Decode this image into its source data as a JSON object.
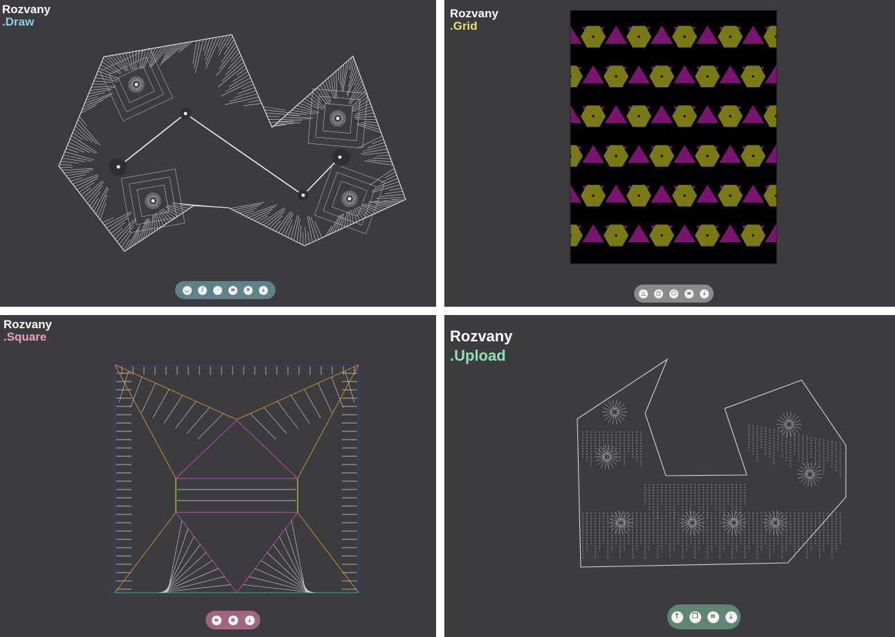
{
  "panels": {
    "draw": {
      "app_title": "Rozvany",
      "mode": ".Draw",
      "mode_color": "#8ecfe0",
      "toolbar_color": "#5e818c",
      "toolbar": [
        {
          "icon": "undo-icon",
          "glyph": "◡"
        },
        {
          "icon": "line-icon",
          "glyph": "/"
        },
        {
          "icon": "point-icon",
          "glyph": "·"
        },
        {
          "icon": "layers-icon",
          "glyph": "≡"
        },
        {
          "icon": "clear-icon",
          "glyph": "✕"
        },
        {
          "icon": "download-icon",
          "glyph": "⤓"
        }
      ]
    },
    "grid": {
      "app_title": "Rozvany",
      "mode": ".Grid",
      "mode_color": "#e5e07a",
      "toolbar_color": "#8b8b8b",
      "colors": {
        "hex": "#7a7a14",
        "tri": "#7a1470",
        "band": "#138080"
      },
      "toolbar": [
        {
          "icon": "triangle-icon",
          "glyph": "△"
        },
        {
          "icon": "square-icon",
          "glyph": "◻"
        },
        {
          "icon": "hexagon-icon",
          "glyph": "⬡"
        },
        {
          "icon": "layers-icon",
          "glyph": "≡"
        },
        {
          "icon": "download-icon",
          "glyph": "⤓"
        }
      ]
    },
    "square": {
      "app_title": "Rozvany",
      "mode": ".Square",
      "mode_color": "#f09ac8",
      "toolbar_color": "#a06680",
      "toolbar": [
        {
          "icon": "layers-icon",
          "glyph": "≡"
        },
        {
          "icon": "pattern-icon",
          "glyph": "⊕"
        },
        {
          "icon": "download-icon",
          "glyph": "⤓"
        }
      ]
    },
    "upload": {
      "app_title": "Rozvany",
      "mode": ".Upload",
      "mode_color": "#8fe0b4",
      "toolbar_color": "#5f8672",
      "toolbar": [
        {
          "icon": "upload-icon",
          "glyph": "↑"
        },
        {
          "icon": "copy-icon",
          "glyph": "❐"
        },
        {
          "icon": "layers-icon",
          "glyph": "≡"
        },
        {
          "icon": "download-icon",
          "glyph": "⤓"
        }
      ]
    }
  }
}
